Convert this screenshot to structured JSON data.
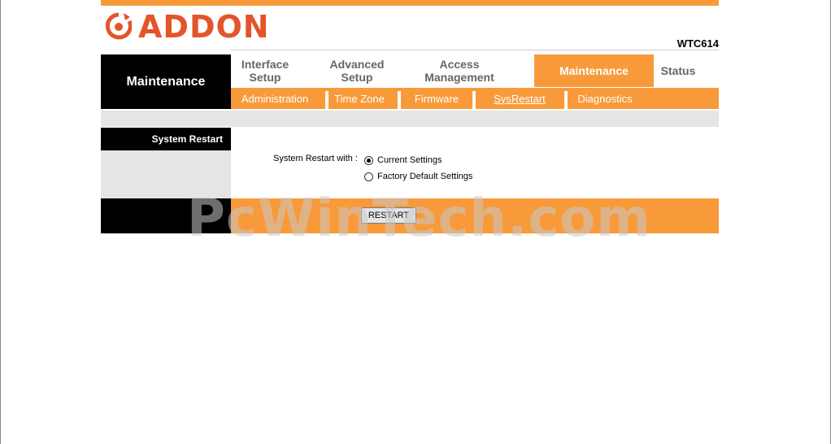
{
  "brand": {
    "logo_text": "ADDON",
    "model": "WTC614",
    "accent": "#f89a3a",
    "logo_color": "#e4542a"
  },
  "section_title": "Maintenance",
  "main_tabs": [
    {
      "line1": "Interface",
      "line2": "Setup"
    },
    {
      "line1": "Advanced",
      "line2": "Setup"
    },
    {
      "line1": "Access",
      "line2": "Management"
    },
    {
      "line1": "Maintenance",
      "line2": ""
    },
    {
      "line1": "Status",
      "line2": ""
    }
  ],
  "sub_tabs": [
    "Administration",
    "Time Zone",
    "Firmware",
    "SysRestart",
    "Diagnostics"
  ],
  "side_heading": "System Restart",
  "form": {
    "label": "System Restart with :",
    "options": [
      "Current Settings",
      "Factory Default Settings"
    ],
    "selected": "Current Settings"
  },
  "restart_button": "RESTART",
  "watermark": "PcWinTech.com"
}
